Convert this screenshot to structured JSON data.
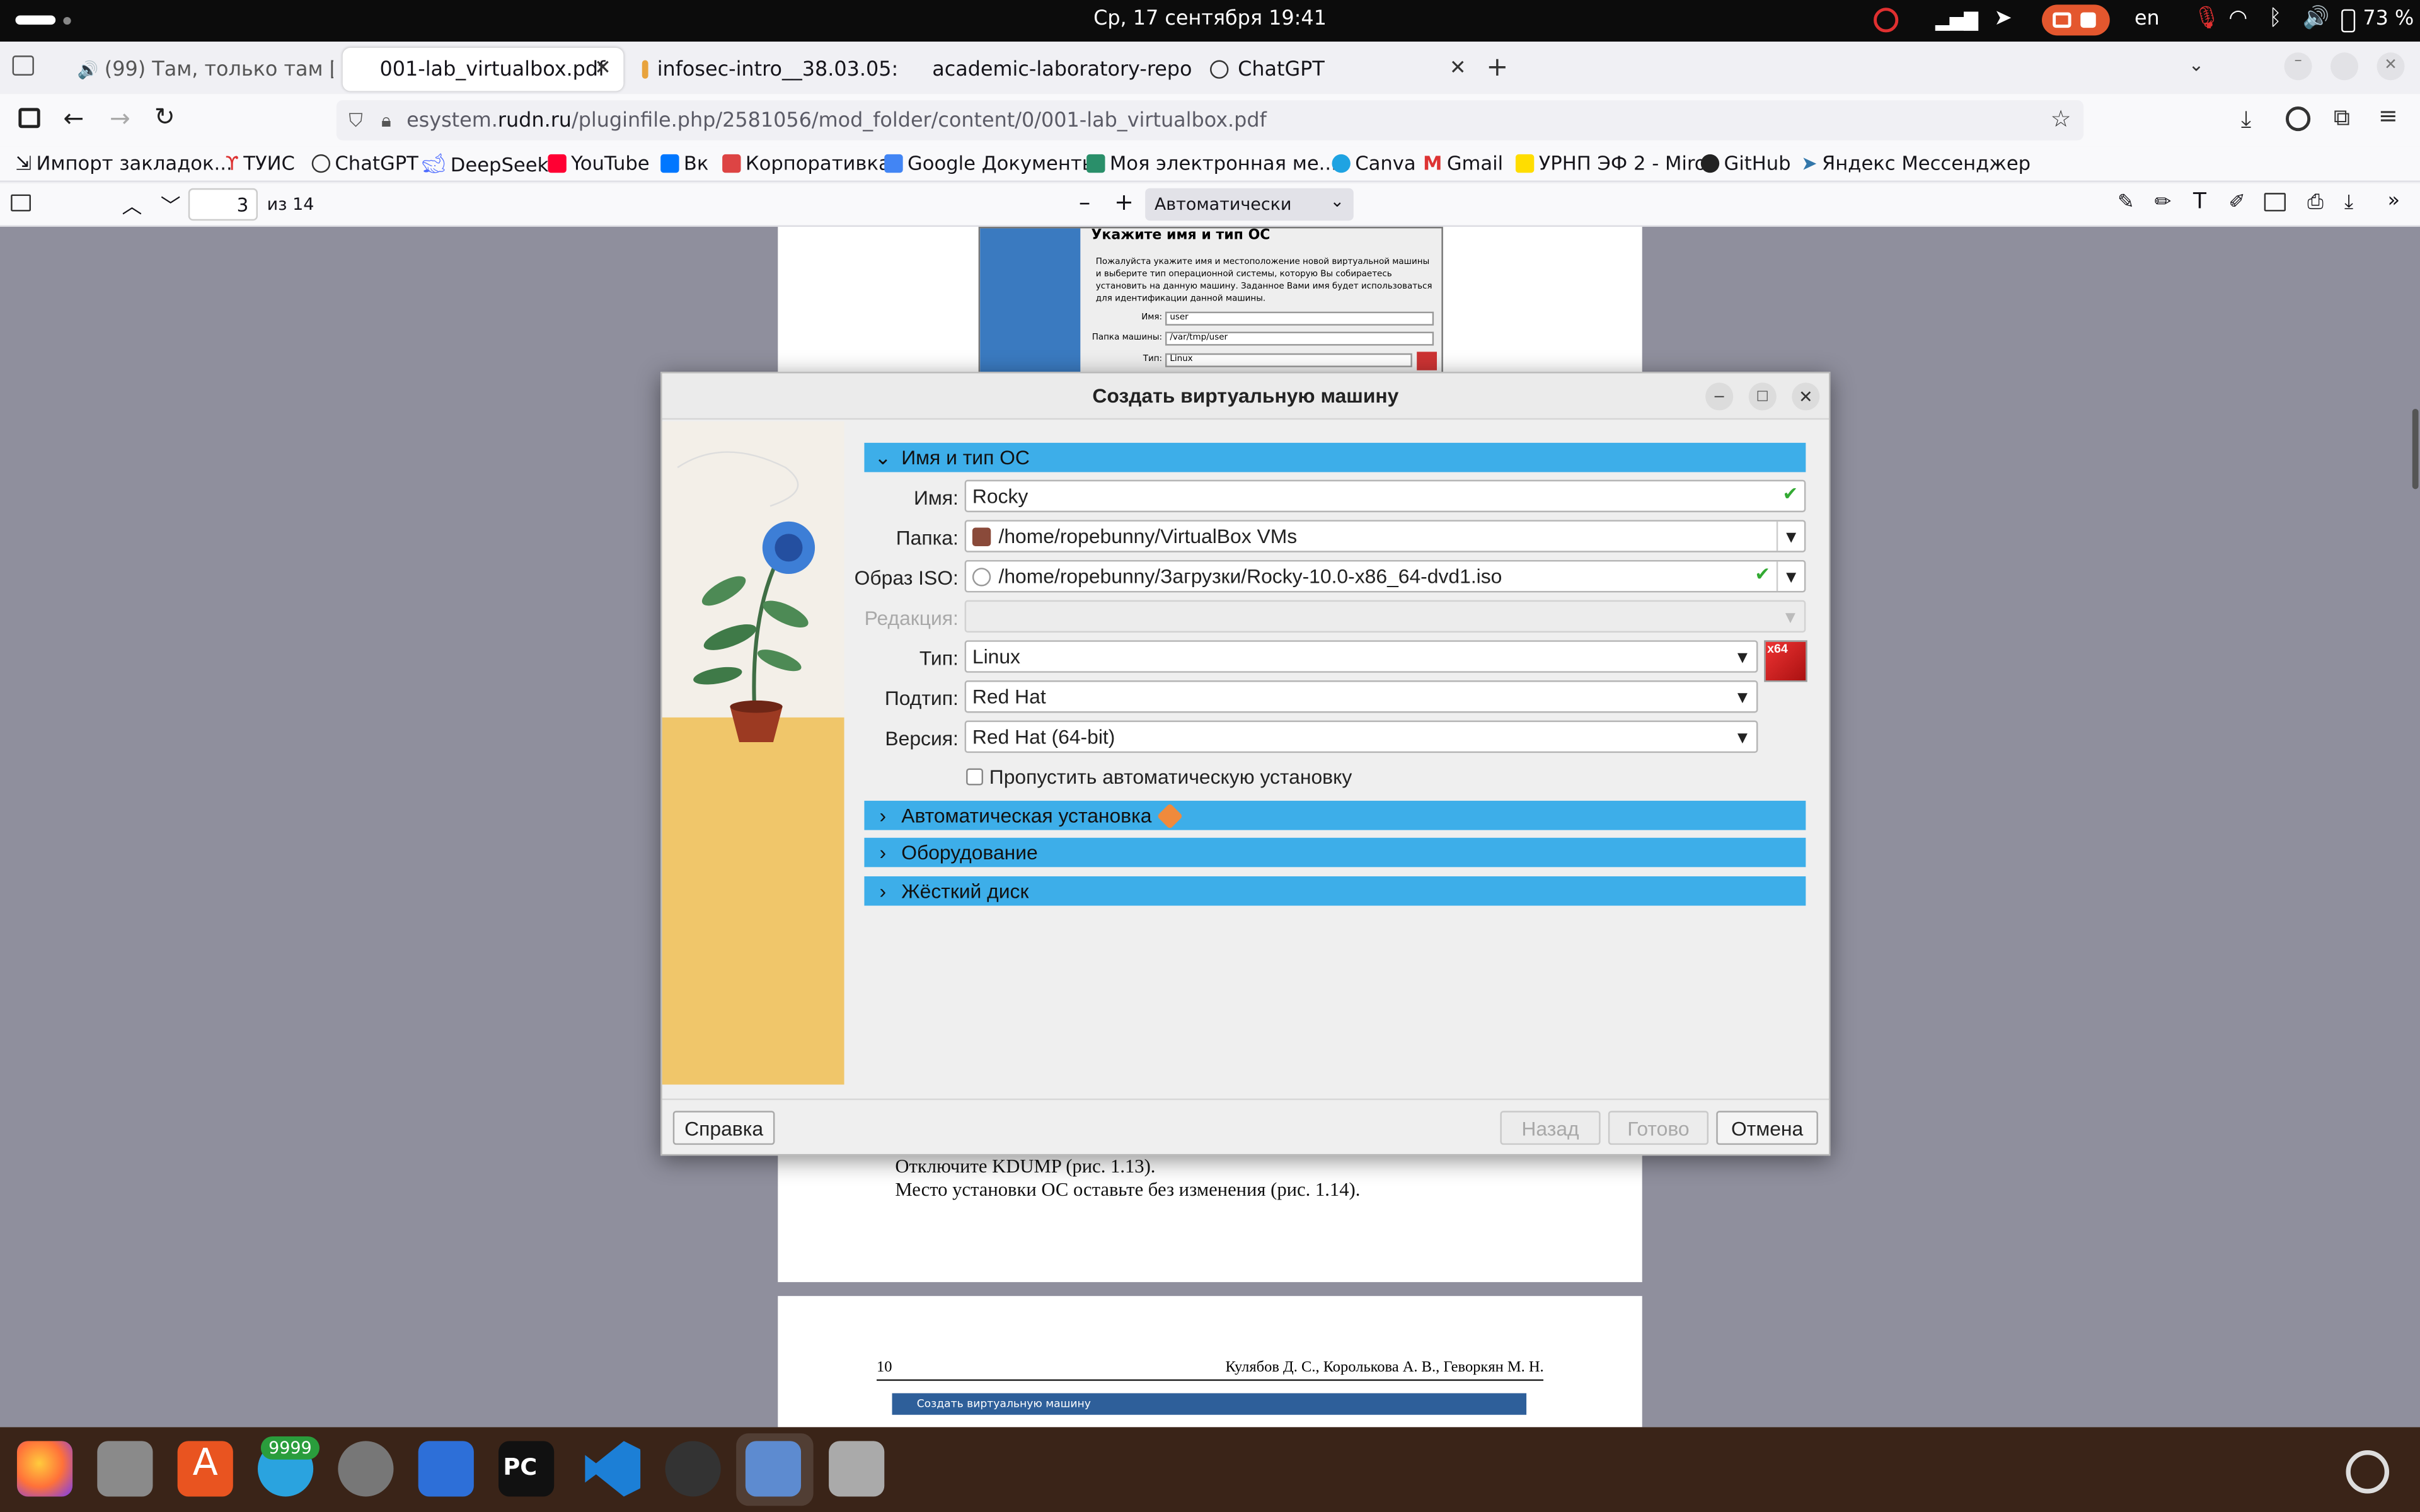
{
  "system": {
    "datetime": "Ср, 17 сентября 19:41",
    "lang": "en",
    "battery": "73 %"
  },
  "tabs": [
    {
      "title": "(99) Там, только там [",
      "icon": "youtube-icon",
      "audio": true
    },
    {
      "title": "001-lab_virtualbox.pdf",
      "active": true
    },
    {
      "title": "infosec-intro__38.03.05: "
    },
    {
      "title": "academic-laboratory-repo"
    },
    {
      "title": "ChatGPT"
    }
  ],
  "url": {
    "host": "esystem.rudn.ru",
    "full_prefix": "esystem.",
    "domain": "rudn.ru",
    "path": "/pluginfile.php/2581056/mod_folder/content/0/001-lab_virtualbox.pdf"
  },
  "bookmarks": [
    "Импорт закладок...",
    "ТУИС",
    "ChatGPT",
    "DeepSeek",
    "YouTube",
    "Вк",
    "Корпоративка",
    "Google Документы",
    "Моя электронная ме...",
    "Canva",
    "Gmail",
    "УРНП ЭФ 2 - Miro",
    "GitHub",
    "Яндекс Мессенджер"
  ],
  "pdf": {
    "page": "3",
    "of": "из 14",
    "zoom": "Автоматически"
  },
  "pdfpage": {
    "snippet_title": "Укажите имя и тип ОС",
    "snippet_text": "Пожалуйста укажите имя и местоположение новой виртуальной машины и выберите тип операционной системы, которую Вы собираетесь установить на данную машину. Заданное Вами имя будет использоваться для идентификации данной машины.",
    "snippet_name_label": "Имя:",
    "snippet_name": "user",
    "snippet_folder_label": "Папка машины:",
    "snippet_folder": "/var/tmp/user",
    "snippet_type_label": "Тип:",
    "snippet_type": "Linux",
    "line1": "Отключите KDUMP (рис. 1.13).",
    "line2": "Место установки ОС оставьте без изменения (рис. 1.14).",
    "page_num": "10",
    "authors": "Кулябов Д. С., Королькова А. В., Геворкян М. Н.",
    "window_title": "Создать виртуальную машину"
  },
  "dialog": {
    "title": "Создать виртуальную машину",
    "section_name": "Имя и тип ОС",
    "name_label": "Имя:",
    "name_value": "Rocky",
    "folder_label": "Папка:",
    "folder_value": "/home/ropebunny/VirtualBox VMs",
    "iso_label": "Образ ISO:",
    "iso_value": "/home/ropebunny/Загрузки/Rocky-10.0-x86_64-dvd1.iso",
    "edition_label": "Редакция:",
    "edition_value": "",
    "type_label": "Тип:",
    "type_value": "Linux",
    "subtype_label": "Подтип:",
    "subtype_value": "Red Hat",
    "version_label": "Версия:",
    "version_value": "Red Hat (64-bit)",
    "os_badge": "x64",
    "skip_label": "Пропустить автоматическую установку",
    "skip_checked": false,
    "section_auto": "Автоматическая установка",
    "section_hw": "Оборудование",
    "section_hdd": "Жёсткий диск",
    "btn_help": "Справка",
    "btn_back": "Назад",
    "btn_finish": "Готово",
    "btn_cancel": "Отмена"
  },
  "dock": {
    "telegram_badge": "9999"
  },
  "colors": {
    "accent": "#3daee9",
    "dock": "#3a2418",
    "topbar": "#0c0c0c"
  }
}
